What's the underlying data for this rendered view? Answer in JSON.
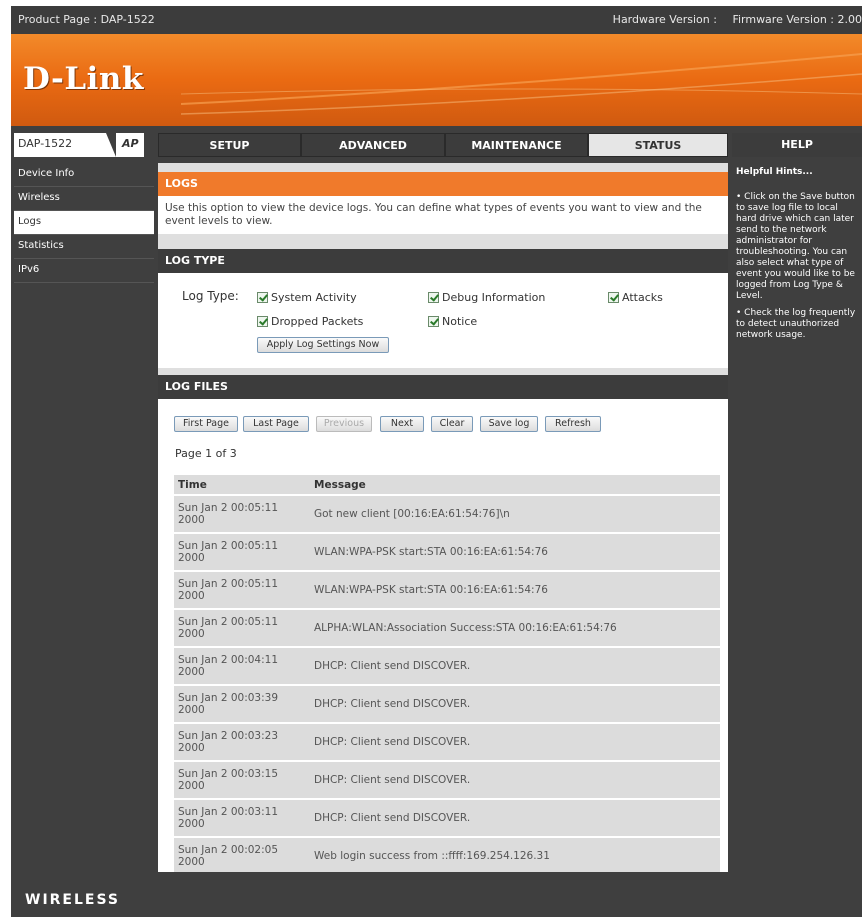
{
  "topbar": {
    "product": "Product Page : DAP-1522",
    "hardware": "Hardware Version :",
    "firmware": "Firmware Version : 2.00"
  },
  "brand": {
    "logo": "D-Link"
  },
  "nav": {
    "model": "DAP-1522",
    "mode": "AP",
    "tabs": [
      {
        "label": "SETUP",
        "active": false
      },
      {
        "label": "ADVANCED",
        "active": false
      },
      {
        "label": "MAINTENANCE",
        "active": false
      },
      {
        "label": "STATUS",
        "active": true
      }
    ],
    "help": "HELP"
  },
  "sidebar": {
    "items": [
      {
        "label": "Device Info"
      },
      {
        "label": "Wireless"
      },
      {
        "label": "Logs"
      },
      {
        "label": "Statistics"
      },
      {
        "label": "IPv6"
      }
    ]
  },
  "logs": {
    "title": "LOGS",
    "intro": "Use this option to view the device logs. You can define what types of events you want to view and the event levels to view."
  },
  "logtype": {
    "title": "LOG TYPE",
    "label": "Log Type:",
    "options": {
      "system": "System Activity",
      "debug": "Debug Information",
      "attacks": "Attacks",
      "dropped": "Dropped Packets",
      "notice": "Notice"
    },
    "apply": "Apply Log Settings Now"
  },
  "logfiles": {
    "title": "LOG FILES",
    "buttons": {
      "first": "First Page",
      "last": "Last Page",
      "previous": "Previous",
      "next": "Next",
      "clear": "Clear",
      "save": "Save log",
      "refresh": "Refresh"
    },
    "page_info": "Page 1 of 3",
    "columns": {
      "time": "Time",
      "message": "Message"
    },
    "rows": [
      {
        "time": "Sun Jan 2 00:05:11 2000",
        "message": "Got new client [00:16:EA:61:54:76]\\n"
      },
      {
        "time": "Sun Jan 2 00:05:11 2000",
        "message": "WLAN:WPA-PSK start:STA 00:16:EA:61:54:76"
      },
      {
        "time": "Sun Jan 2 00:05:11 2000",
        "message": "WLAN:WPA-PSK start:STA 00:16:EA:61:54:76"
      },
      {
        "time": "Sun Jan 2 00:05:11 2000",
        "message": "ALPHA:WLAN:Association Success:STA 00:16:EA:61:54:76"
      },
      {
        "time": "Sun Jan 2 00:04:11 2000",
        "message": "DHCP: Client send DISCOVER."
      },
      {
        "time": "Sun Jan 2 00:03:39 2000",
        "message": "DHCP: Client send DISCOVER."
      },
      {
        "time": "Sun Jan 2 00:03:23 2000",
        "message": "DHCP: Client send DISCOVER."
      },
      {
        "time": "Sun Jan 2 00:03:15 2000",
        "message": "DHCP: Client send DISCOVER."
      },
      {
        "time": "Sun Jan 2 00:03:11 2000",
        "message": "DHCP: Client send DISCOVER."
      },
      {
        "time": "Sun Jan 2 00:02:05 2000",
        "message": "Web login success from ::ffff:169.254.126.31"
      }
    ]
  },
  "help": {
    "title": "Helpful Hints...",
    "hints": [
      "• Click on the Save button to save log file to local hard drive which can later send to the network administrator for troubleshooting. You can also select what type of event you would like to be logged from Log Type & Level.",
      "• Check the log frequently to detect unauthorized network usage."
    ]
  },
  "footer": {
    "label": "WIRELESS"
  }
}
